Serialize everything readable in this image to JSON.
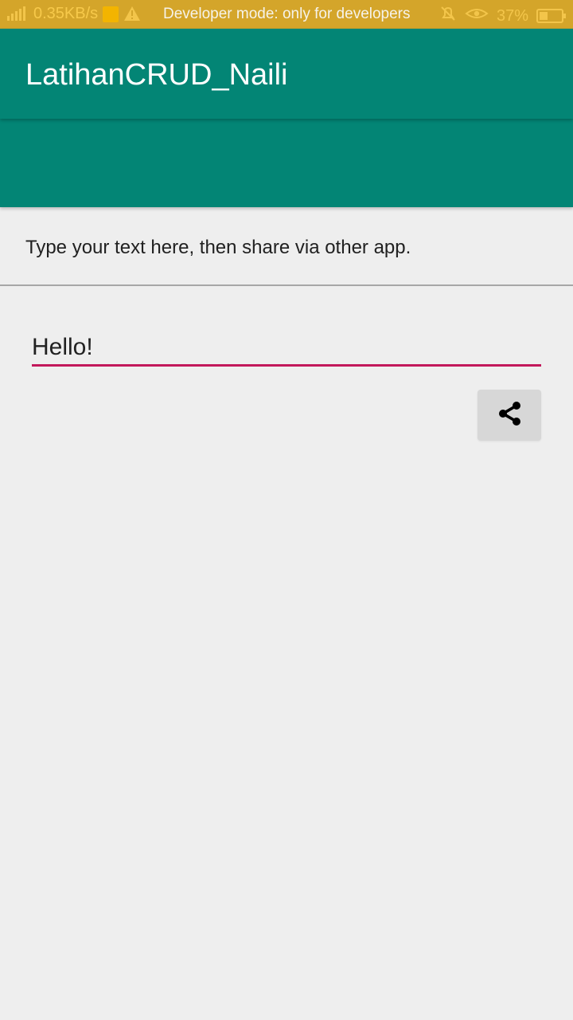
{
  "status_bar": {
    "network": "0.35KB/s",
    "developer_mode": "Developer mode: only for developers",
    "battery_percent": "37%",
    "battery_level": 0.37
  },
  "app_bar": {
    "title": "LatihanCRUD_Naili"
  },
  "content": {
    "instruction": "Type your text here, then share via other app.",
    "input_value": "Hello!"
  }
}
